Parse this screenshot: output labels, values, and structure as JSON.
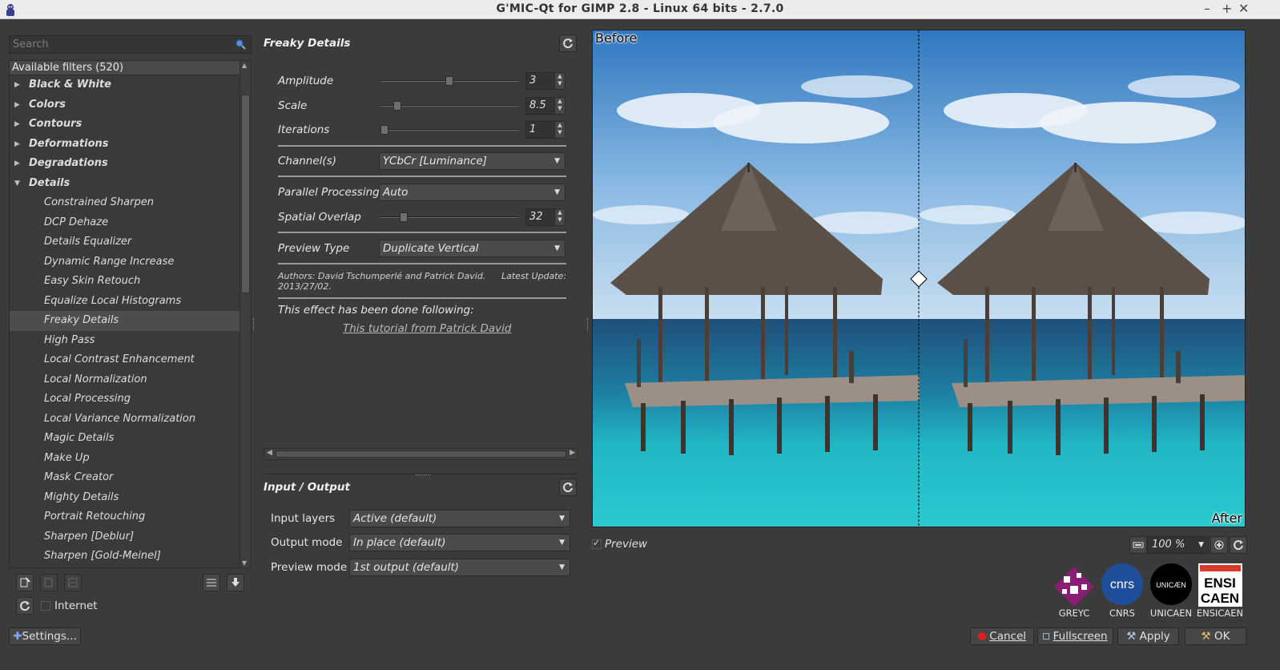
{
  "window": {
    "title": "G'MIC-Qt for GIMP 2.8 - Linux 64 bits - 2.7.0",
    "controls": [
      "–",
      "+",
      "✕"
    ]
  },
  "search": {
    "placeholder": "Search",
    "value": ""
  },
  "filters": {
    "header": "Available filters (520)",
    "categories": [
      "Black & White",
      "Colors",
      "Contours",
      "Deformations",
      "Degradations"
    ],
    "open_category": "Details",
    "items": [
      "Constrained Sharpen",
      "DCP Dehaze",
      "Details Equalizer",
      "Dynamic Range Increase",
      "Easy Skin Retouch",
      "Equalize Local Histograms",
      "Freaky Details",
      "High Pass",
      "Local Contrast Enhancement",
      "Local Normalization",
      "Local Processing",
      "Local Variance Normalization",
      "Magic Details",
      "Make Up",
      "Mask Creator",
      "Mighty Details",
      "Portrait Retouching",
      "Sharpen [Deblur]",
      "Sharpen [Gold-Meinel]"
    ],
    "selected": "Freaky Details",
    "internet_label": "Internet",
    "internet_checked": false
  },
  "settings_button": "Settings...",
  "filter_panel": {
    "title": "Freaky Details",
    "params": {
      "amplitude": {
        "label": "Amplitude",
        "value": "3",
        "fraction": 0.5
      },
      "scale": {
        "label": "Scale",
        "value": "8.5",
        "fraction": 0.1
      },
      "iterations": {
        "label": "Iterations",
        "value": "1",
        "fraction": 0.0
      },
      "channels": {
        "label": "Channel(s)",
        "value": "YCbCr [Luminance]"
      },
      "parallel": {
        "label": "Parallel Processing",
        "value": "Auto"
      },
      "overlap": {
        "label": "Spatial Overlap",
        "value": "32",
        "fraction": 0.15
      },
      "preview_type": {
        "label": "Preview Type",
        "value": "Duplicate Vertical"
      }
    },
    "authors": "Authors: David Tschumperlé and Patrick David.",
    "latest_update_label": "Latest Update:",
    "date": "2013/27/02.",
    "note": "This effect has been done following:",
    "link": "This tutorial from Patrick David"
  },
  "io_panel": {
    "title": "Input / Output",
    "input_layers": {
      "label": "Input layers",
      "value": "Active (default)"
    },
    "output_mode": {
      "label": "Output mode",
      "value": "In place (default)"
    },
    "preview_mode": {
      "label": "Preview mode",
      "value": "1st output (default)"
    }
  },
  "preview": {
    "before_label": "Before",
    "after_label": "After",
    "checkbox_label": "Preview",
    "checked": true,
    "zoom": "100 %"
  },
  "logos": [
    "GREYC",
    "CNRS",
    "UNICAEN",
    "ENSICAEN"
  ],
  "logo_marks": {
    "cnrs": "cnrs",
    "unicaen": "UNICÆN",
    "ensi": "ENSI",
    "caen": "CAEN"
  },
  "buttons": {
    "cancel": "Cancel",
    "fullscreen": "Fullscreen",
    "apply": "Apply",
    "ok": "OK"
  },
  "colors": {
    "background": "#3b3b3b",
    "sky": "#3f86c6",
    "sea_turquoise": "#29c0c9",
    "cancel_dot": "#e02020"
  }
}
